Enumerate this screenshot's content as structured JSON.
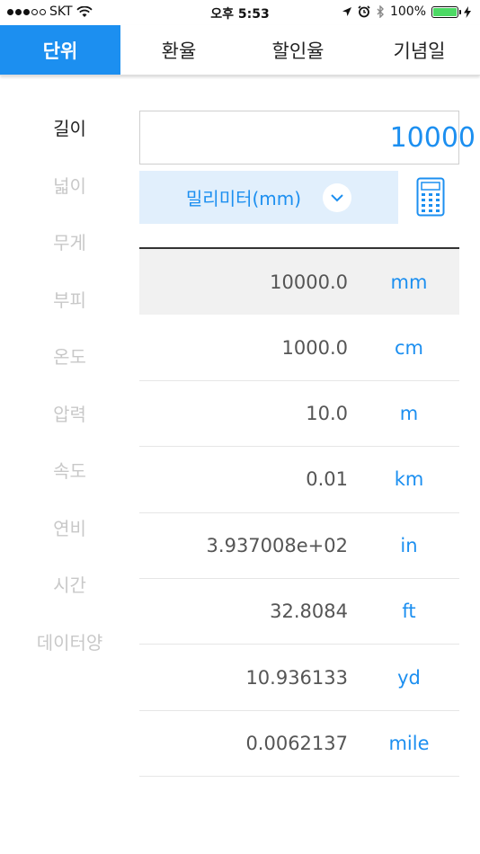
{
  "status_bar": {
    "carrier": "SKT",
    "time": "오후 5:53",
    "battery": "100%",
    "signal_bars_full": 3,
    "signal_bars_total": 5
  },
  "tabs": [
    {
      "label": "단위",
      "active": true
    },
    {
      "label": "환율",
      "active": false
    },
    {
      "label": "할인율",
      "active": false
    },
    {
      "label": "기념일",
      "active": false
    }
  ],
  "categories": [
    {
      "label": "길이",
      "active": true
    },
    {
      "label": "넓이",
      "active": false
    },
    {
      "label": "무게",
      "active": false
    },
    {
      "label": "부피",
      "active": false
    },
    {
      "label": "온도",
      "active": false
    },
    {
      "label": "압력",
      "active": false
    },
    {
      "label": "속도",
      "active": false
    },
    {
      "label": "연비",
      "active": false
    },
    {
      "label": "시간",
      "active": false
    },
    {
      "label": "데이터양",
      "active": false
    }
  ],
  "input": {
    "value": "10000"
  },
  "unit_select": {
    "selected": "밀리미터(mm)"
  },
  "results": [
    {
      "value": "10000.0",
      "unit": "mm",
      "highlight": true
    },
    {
      "value": "1000.0",
      "unit": "cm",
      "highlight": false
    },
    {
      "value": "10.0",
      "unit": "m",
      "highlight": false
    },
    {
      "value": "0.01",
      "unit": "km",
      "highlight": false
    },
    {
      "value": "3.937008e+02",
      "unit": "in",
      "highlight": false
    },
    {
      "value": "32.8084",
      "unit": "ft",
      "highlight": false
    },
    {
      "value": "10.936133",
      "unit": "yd",
      "highlight": false
    },
    {
      "value": "0.0062137",
      "unit": "mile",
      "highlight": false
    }
  ],
  "colors": {
    "accent": "#1c8ff0",
    "select_bg": "#e1effc",
    "battery": "#4cd964"
  }
}
